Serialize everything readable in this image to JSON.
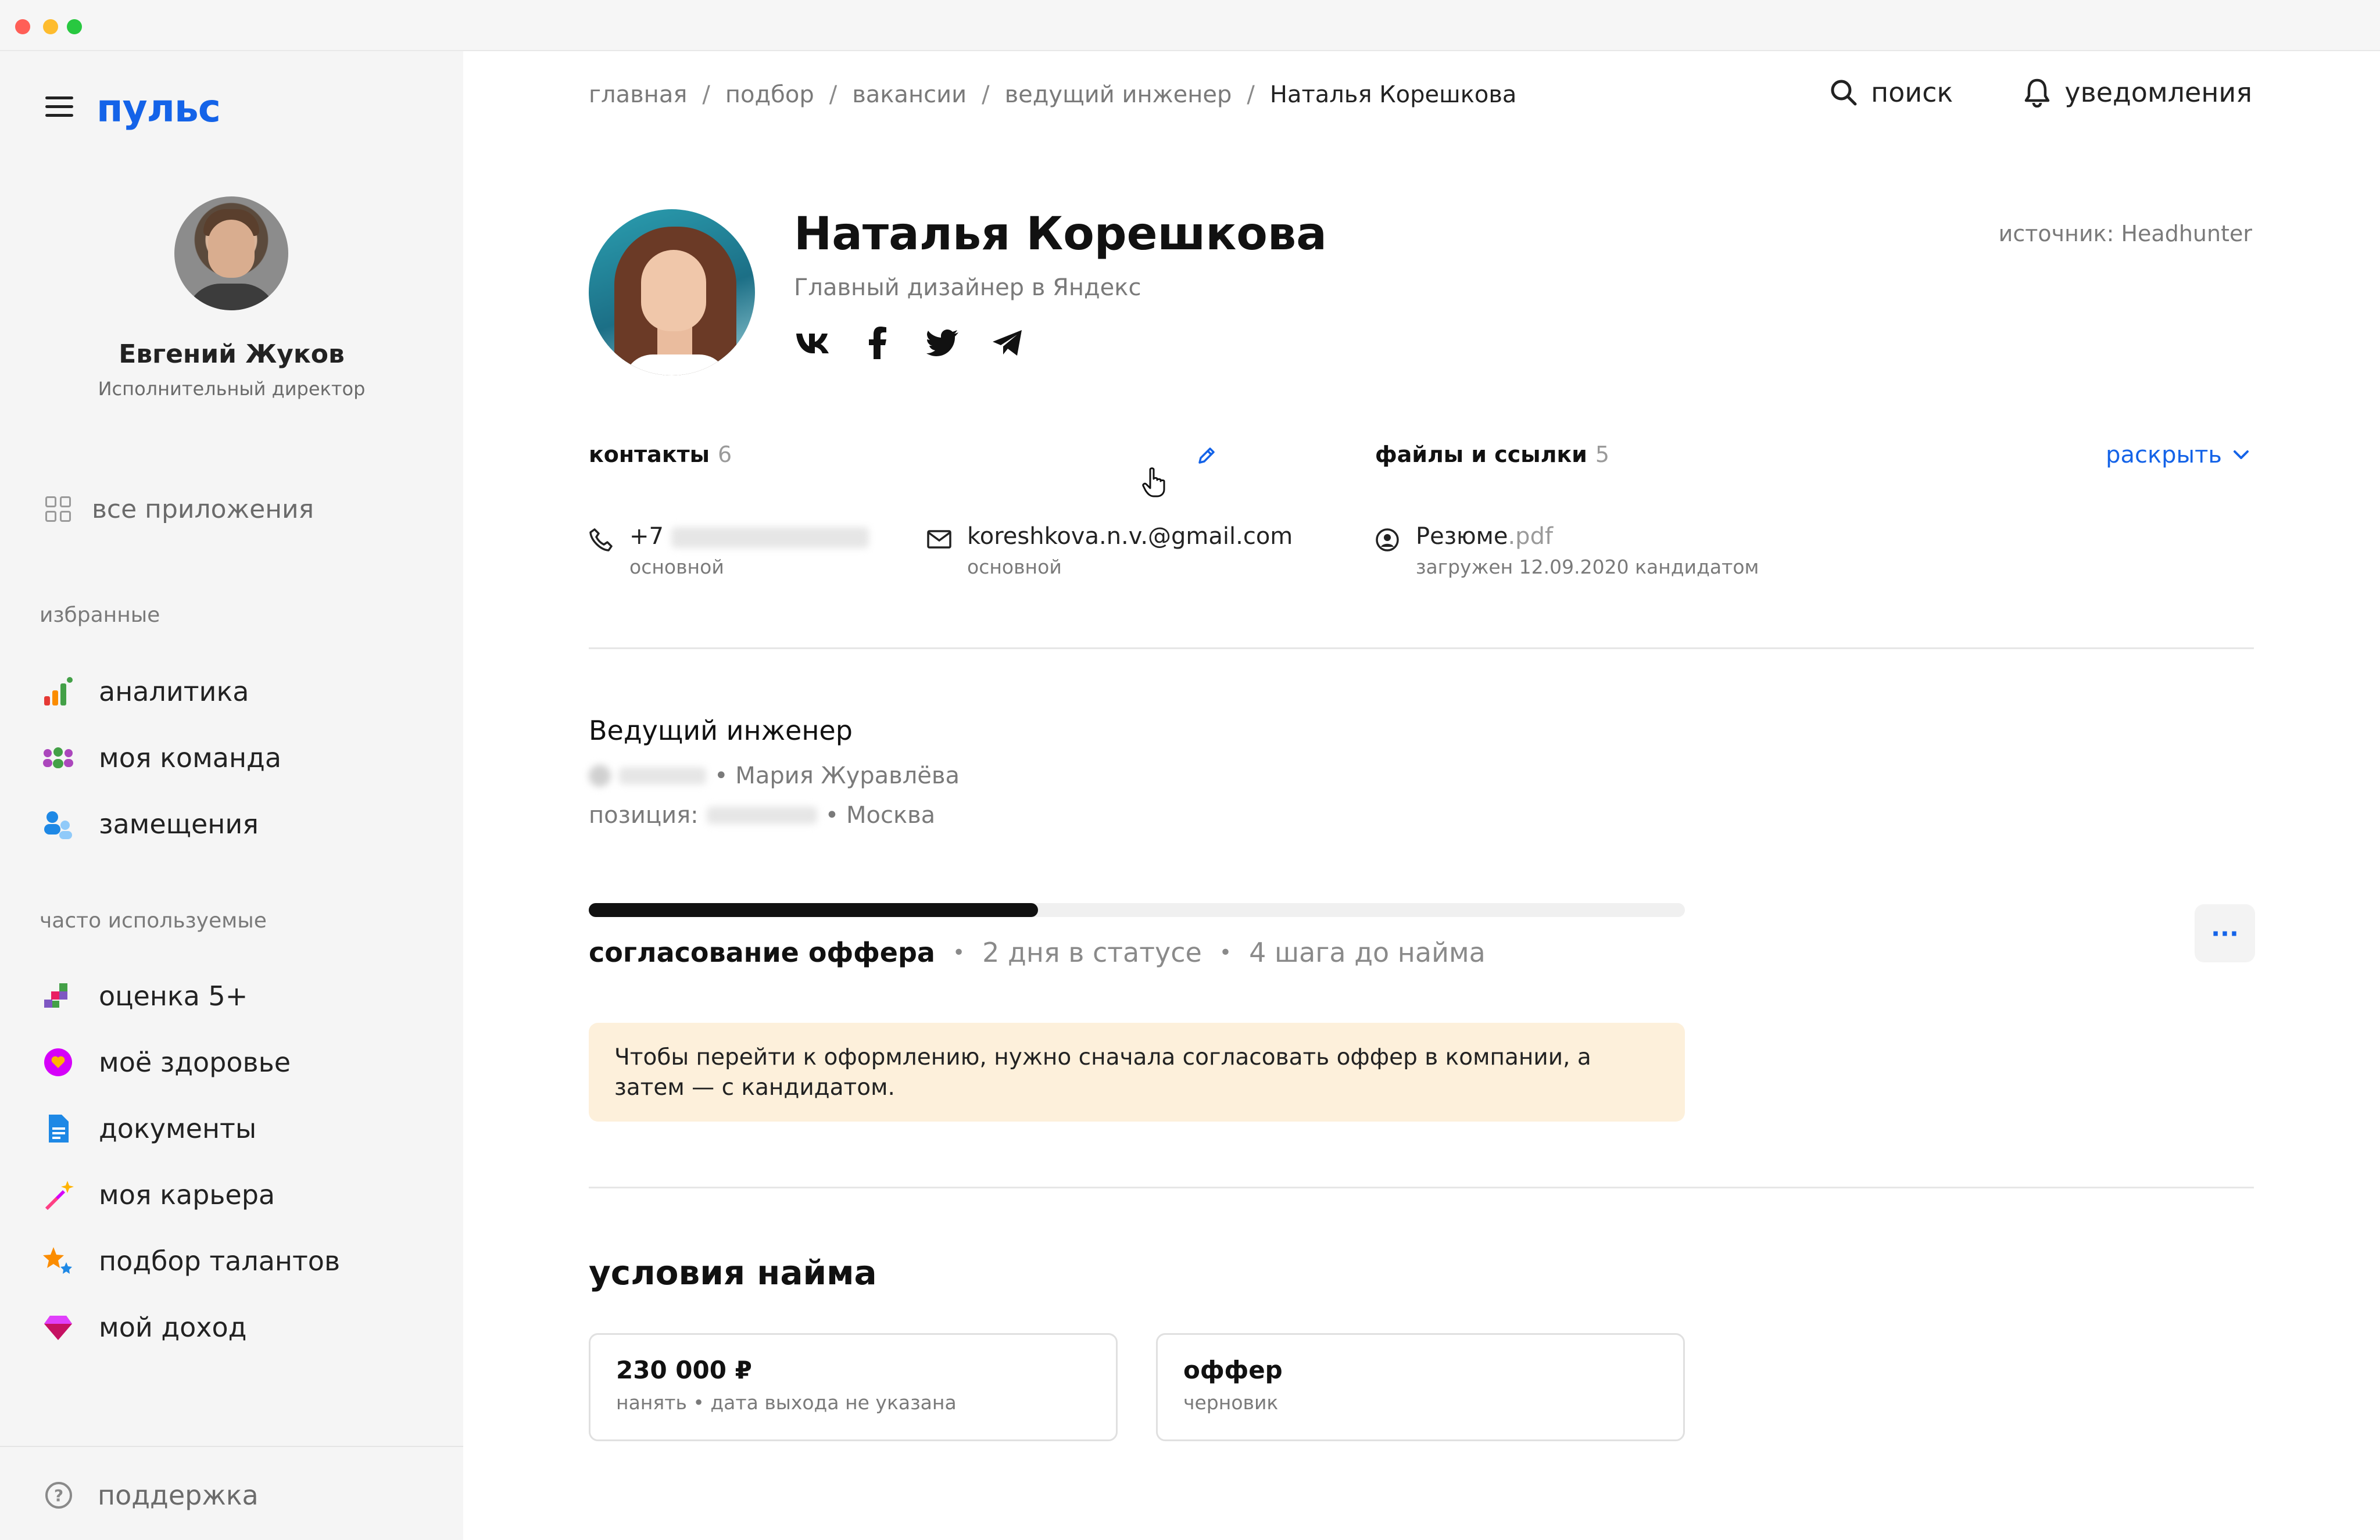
{
  "app": {
    "logo": "пульс"
  },
  "user": {
    "name": "Евгений Жуков",
    "role": "Исполнительный директор"
  },
  "sidebar": {
    "all_apps": "все приложения",
    "favorites_title": "избранные",
    "favorites": [
      {
        "label": "аналитика",
        "icon": "chart-icon"
      },
      {
        "label": "моя команда",
        "icon": "team-icon"
      },
      {
        "label": "замещения",
        "icon": "substitution-icon"
      }
    ],
    "frequent_title": "часто используемые",
    "frequent": [
      {
        "label": "оценка 5+",
        "icon": "rating-icon"
      },
      {
        "label": "моё здоровье",
        "icon": "health-icon"
      },
      {
        "label": "документы",
        "icon": "document-icon"
      },
      {
        "label": "моя карьера",
        "icon": "career-icon"
      },
      {
        "label": "подбор талантов",
        "icon": "talent-icon"
      },
      {
        "label": "мой доход",
        "icon": "income-icon"
      }
    ],
    "support": "поддержка"
  },
  "breadcrumb": [
    "главная",
    "подбор",
    "вакансии",
    "ведущий инженер",
    "Наталья Корешкова"
  ],
  "top_actions": {
    "search": "поиск",
    "notifications": "уведомления"
  },
  "candidate": {
    "name": "Наталья Корешкова",
    "title": "Главный дизайнер в Яндекс",
    "source": "источник: Headhunter",
    "socials": [
      "vk-icon",
      "facebook-icon",
      "twitter-icon",
      "telegram-icon"
    ]
  },
  "contacts": {
    "title": "контакты",
    "count": "6",
    "phone": {
      "prefix": "+7",
      "label": "основной"
    },
    "email": {
      "value": "koreshkova.n.v.@gmail.com",
      "label": "основной"
    }
  },
  "files": {
    "title": "файлы и ссылки",
    "count": "5",
    "expand": "раскрыть",
    "resume": {
      "name": "Резюме",
      "ext": ".pdf",
      "note": "загружен 12.09.2020 кандидатом"
    }
  },
  "vacancy": {
    "title": "Ведущий инженер",
    "recruiter": "• Мария Журавлёва",
    "position_label": "позиция:",
    "city": "• Москва"
  },
  "status": {
    "stage": "согласование оффера",
    "days": "2 дня в статусе",
    "steps": "4 шага до найма",
    "progress": 0.41,
    "more": "···",
    "notice": "Чтобы перейти к оформлению, нужно сначала согласовать оффер в компании, а затем — с кандидатом."
  },
  "conditions": {
    "title": "условия найма",
    "salary": {
      "value": "230 000 ₽",
      "note": "нанять • дата выхода не указана"
    },
    "offer": {
      "value": "оффер",
      "note": "черновик"
    }
  },
  "colors": {
    "accent": "#1463e8",
    "notice_bg": "#fdf0db",
    "sidebar_bg": "#f5f5f5"
  }
}
